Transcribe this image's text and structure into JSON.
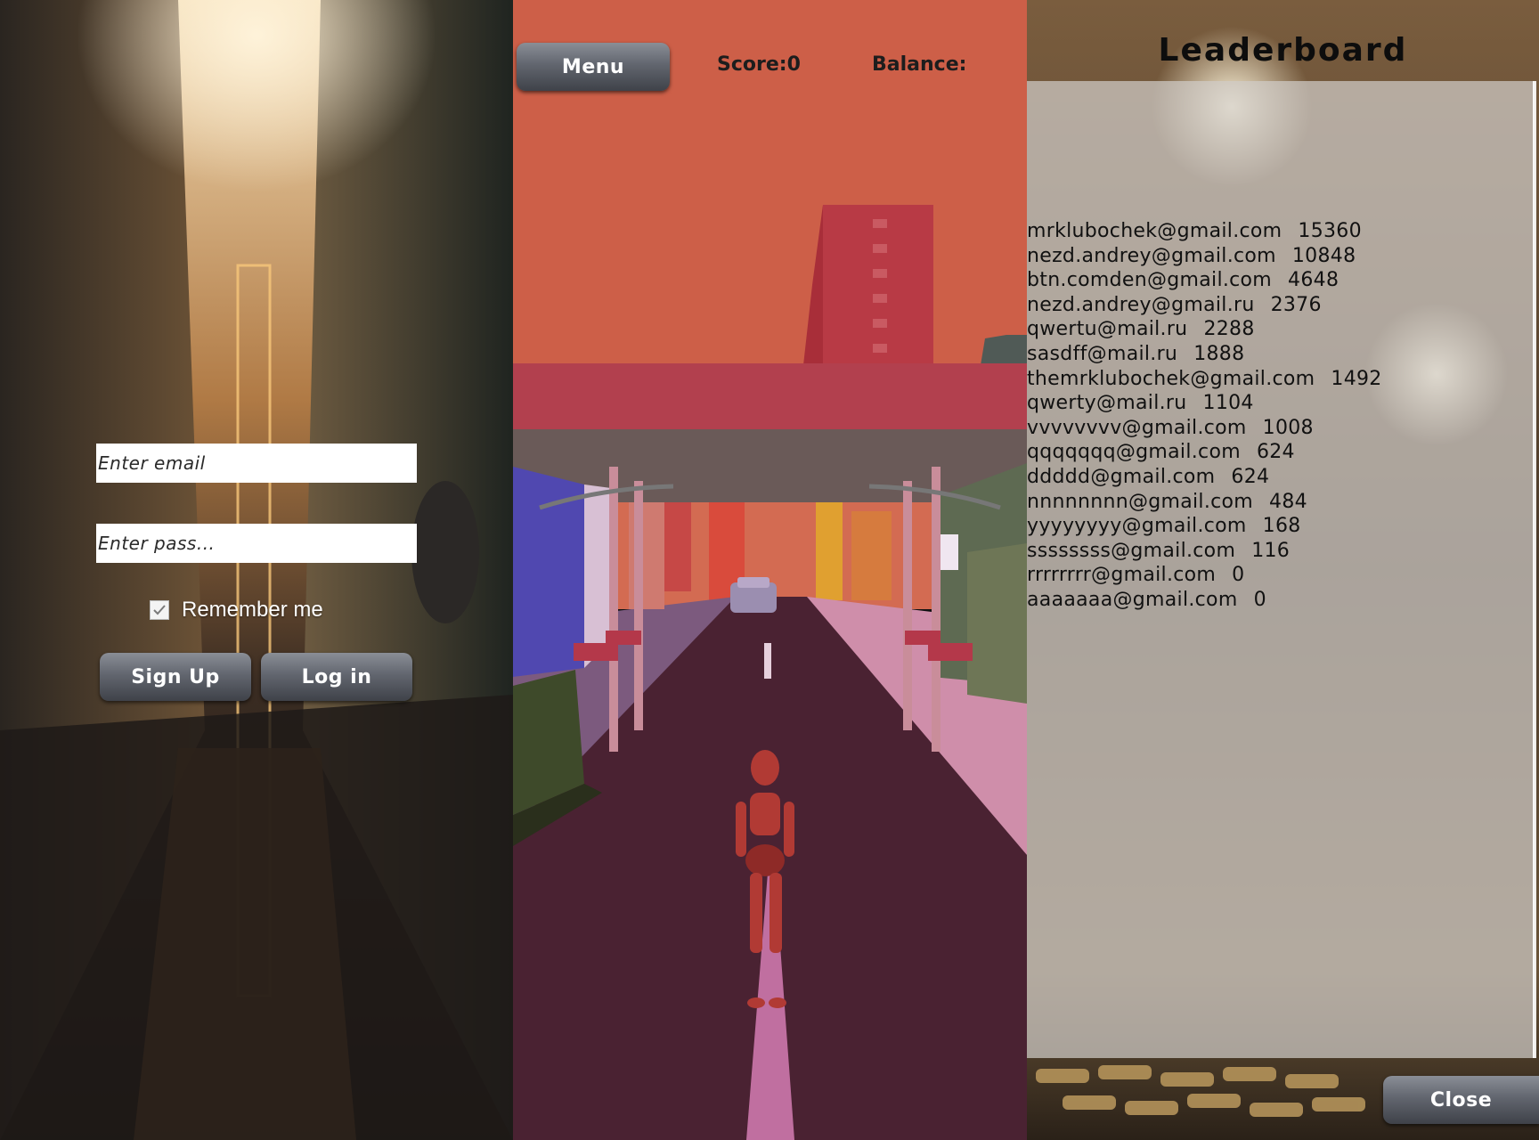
{
  "login": {
    "email_placeholder": "Enter email",
    "pass_placeholder": "Enter pass...",
    "remember_label": "Remember me",
    "remember_checked": true,
    "signup_label": "Sign Up",
    "login_label": "Log in"
  },
  "hud": {
    "menu_label": "Menu",
    "score_label": "Score:0",
    "balance_label": "Balance:"
  },
  "leaderboard": {
    "title": "Leaderboard",
    "close_label": "Close",
    "entries": [
      {
        "email": "mrklubochek@gmail.com",
        "score": "15360"
      },
      {
        "email": "nezd.andrey@gmail.com",
        "score": "10848"
      },
      {
        "email": "btn.comden@gmail.com",
        "score": "4648"
      },
      {
        "email": "nezd.andrey@gmail.ru",
        "score": "2376"
      },
      {
        "email": "qwertu@mail.ru",
        "score": "2288"
      },
      {
        "email": "sasdff@mail.ru",
        "score": "1888"
      },
      {
        "email": "themrklubochek@gmail.com",
        "score": "1492"
      },
      {
        "email": "qwerty@mail.ru",
        "score": "1104"
      },
      {
        "email": "vvvvvvvv@gmail.com",
        "score": "1008"
      },
      {
        "email": "qqqqqqq@gmail.com",
        "score": "624"
      },
      {
        "email": "ddddd@gmail.com",
        "score": "624"
      },
      {
        "email": "nnnnnnnn@gmail.com",
        "score": "484"
      },
      {
        "email": "yyyyyyyy@gmail.com",
        "score": "168"
      },
      {
        "email": "ssssssss@gmail.com",
        "score": "116"
      },
      {
        "email": "rrrrrrrr@gmail.com",
        "score": "0"
      },
      {
        "email": "aaaaaaa@gmail.com",
        "score": "0"
      }
    ]
  },
  "icons": {
    "checkbox": "check-icon"
  },
  "colors": {
    "sky": "#cd5f48",
    "road": "#4a2232",
    "bridge": "#b2404e",
    "character": "#b13a34",
    "button_gradient_top": "#8a8e96",
    "button_gradient_bottom": "#3f4249"
  }
}
